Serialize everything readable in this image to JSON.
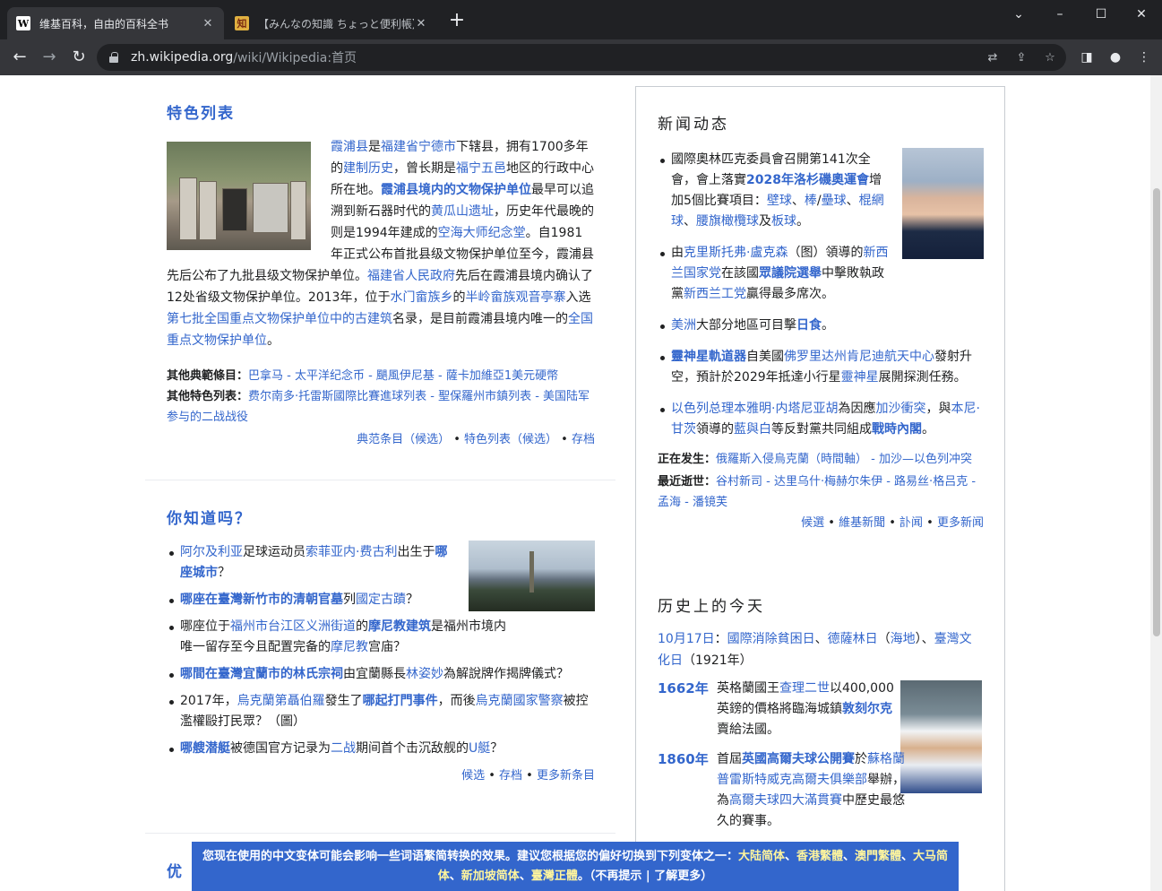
{
  "browser": {
    "tabs": [
      {
        "title": "维基百科，自由的百科全书",
        "favicon": "W",
        "active": true
      },
      {
        "title": "【みんなの知識 ちょっと便利帳】パソコ",
        "favicon": "知",
        "active": false
      }
    ],
    "new_tab": "+",
    "url_host": "zh.wikipedia.org",
    "url_path": "/wiki/Wikipedia:首页",
    "window_controls": {
      "minimize": "–",
      "maximize": "☐",
      "close": "✕",
      "tab_search": "⌄"
    }
  },
  "featured_list": {
    "heading": "特色列表",
    "paragraph": [
      {
        "t": "霞浦县",
        "l": true
      },
      {
        "t": "是",
        "l": false
      },
      {
        "t": "福建省宁德市",
        "l": true
      },
      {
        "t": "下辖县，拥有1700多年的",
        "l": false
      },
      {
        "t": "建制历史",
        "l": true
      },
      {
        "t": "，曾长期是",
        "l": false
      },
      {
        "t": "福宁五邑",
        "l": true
      },
      {
        "t": "地区的行政中心所在地。",
        "l": false
      },
      {
        "t": "霞浦县境内的文物保护单位",
        "l": true,
        "b": true
      },
      {
        "t": "最早可以追溯到新石器时代的",
        "l": false
      },
      {
        "t": "黄瓜山遗址",
        "l": true
      },
      {
        "t": "，历史年代最晚的则是1994年建成的",
        "l": false
      },
      {
        "t": "空海大师纪念堂",
        "l": true
      },
      {
        "t": "。自1981年正式公布首批县级文物保护单位至今，霞浦县先后公布了九批县级文物保护单位。",
        "l": false
      },
      {
        "t": "福建省人民政府",
        "l": true
      },
      {
        "t": "先后在霞浦县境内确认了12处省级文物保护单位。2013年，位于",
        "l": false
      },
      {
        "t": "水门畲族乡",
        "l": true
      },
      {
        "t": "的",
        "l": false
      },
      {
        "t": "半岭畲族观音亭寨",
        "l": true
      },
      {
        "t": "入选",
        "l": false
      },
      {
        "t": "第七批全国重点文物保护单位中的古建筑",
        "l": true
      },
      {
        "t": "名录，是目前霞浦县境内唯一的",
        "l": false
      },
      {
        "t": "全国重点文物保护单位",
        "l": true
      },
      {
        "t": "。",
        "l": false
      }
    ],
    "other_featured_label": "其他典範條目：",
    "other_featured": "巴拿马 - 太平洋纪念币 - 颶風伊尼基 - 薩卡加維亞1美元硬幣",
    "other_lists_label": "其他特色列表：",
    "other_lists": "费尔南多·托雷斯國際比賽進球列表 - 聖保羅州市鎮列表 - 美国陆军参与的二战战役",
    "footer": [
      "典范条目（候选）",
      "特色列表（候选）",
      "存档"
    ]
  },
  "dyk": {
    "heading": "你知道吗？",
    "items": [
      [
        {
          "t": "阿尔及利亚",
          "l": true
        },
        {
          "t": "足球运动员",
          "l": false
        },
        {
          "t": "索菲亚内·费古利",
          "l": true
        },
        {
          "t": "出生于",
          "l": false
        },
        {
          "t": "哪座城市",
          "l": true,
          "b": true
        },
        {
          "t": "？",
          "l": false
        }
      ],
      [
        {
          "t": "哪座在臺灣新竹市的清朝官墓",
          "l": true,
          "b": true
        },
        {
          "t": "列",
          "l": false
        },
        {
          "t": "國定古蹟",
          "l": true
        },
        {
          "t": "？",
          "l": false
        }
      ],
      [
        {
          "t": "哪座位于",
          "l": false
        },
        {
          "t": "福州市台江区义洲街道",
          "l": true
        },
        {
          "t": "的",
          "l": false
        },
        {
          "t": "摩尼教建筑",
          "l": true,
          "b": true
        },
        {
          "t": "是福州市境内唯一留存至今且配置完备的",
          "l": false
        },
        {
          "t": "摩尼教",
          "l": true
        },
        {
          "t": "宫庙？",
          "l": false
        }
      ],
      [
        {
          "t": "哪間在臺灣宜蘭市的林氏宗祠",
          "l": true,
          "b": true
        },
        {
          "t": "由宜蘭縣長",
          "l": false
        },
        {
          "t": "林姿妙",
          "l": true
        },
        {
          "t": "為解說牌作揭牌儀式？",
          "l": false
        }
      ],
      [
        {
          "t": "2017年，",
          "l": false
        },
        {
          "t": "烏克蘭第聶伯羅",
          "l": true
        },
        {
          "t": "發生了",
          "l": false
        },
        {
          "t": "哪起打門事件",
          "l": true,
          "b": true
        },
        {
          "t": "，而後",
          "l": false
        },
        {
          "t": "烏克蘭國家警察",
          "l": true
        },
        {
          "t": "被控濫權毆打民眾？（圖）",
          "l": false
        }
      ],
      [
        {
          "t": "哪艘潜艇",
          "l": true,
          "b": true
        },
        {
          "t": "被德国官方记录为",
          "l": false
        },
        {
          "t": "二战",
          "l": true
        },
        {
          "t": "期间首个击沉敌舰的",
          "l": false
        },
        {
          "t": "U艇",
          "l": true
        },
        {
          "t": "？",
          "l": false
        }
      ]
    ],
    "footer": [
      "候选",
      "存档",
      "更多新条目"
    ]
  },
  "news": {
    "heading": "新闻动态",
    "items": [
      [
        {
          "t": "國際奧林匹克委員會召開第141次全會，會上落實",
          "l": false
        },
        {
          "t": "2028年洛杉磯奧運會",
          "l": true,
          "b": true
        },
        {
          "t": "增加5個比賽項目：",
          "l": false
        },
        {
          "t": "壁球",
          "l": true
        },
        {
          "t": "、",
          "l": false
        },
        {
          "t": "棒",
          "l": true
        },
        {
          "t": "/",
          "l": false
        },
        {
          "t": "壘球",
          "l": true
        },
        {
          "t": "、",
          "l": false
        },
        {
          "t": "棍網球",
          "l": true
        },
        {
          "t": "、",
          "l": false
        },
        {
          "t": "腰旗橄欖球",
          "l": true
        },
        {
          "t": "及",
          "l": false
        },
        {
          "t": "板球",
          "l": true
        },
        {
          "t": "。",
          "l": false
        }
      ],
      [
        {
          "t": "由",
          "l": false
        },
        {
          "t": "克里斯托弗·盧克森",
          "l": true
        },
        {
          "t": "（图）領導的",
          "l": false
        },
        {
          "t": "新西兰国家党",
          "l": true
        },
        {
          "t": "在該國",
          "l": false
        },
        {
          "t": "眾議院選舉",
          "l": true,
          "b": true
        },
        {
          "t": "中擊敗執政黨",
          "l": false
        },
        {
          "t": "新西兰工党",
          "l": true
        },
        {
          "t": "贏得最多席次。",
          "l": false
        }
      ],
      [
        {
          "t": "美洲",
          "l": true
        },
        {
          "t": "大部分地區可目擊",
          "l": false
        },
        {
          "t": "日食",
          "l": true,
          "b": true
        },
        {
          "t": "。",
          "l": false
        }
      ],
      [
        {
          "t": "靈神星軌道器",
          "l": true,
          "b": true
        },
        {
          "t": "自美國",
          "l": false
        },
        {
          "t": "佛罗里达州肯尼迪航天中心",
          "l": true
        },
        {
          "t": "發射升空，預計於2029年抵達小行星",
          "l": false
        },
        {
          "t": "靈神星",
          "l": true
        },
        {
          "t": "展開探測任務。",
          "l": false
        }
      ],
      [
        {
          "t": "以色列总理本雅明·内塔尼亚胡",
          "l": true
        },
        {
          "t": "為因應",
          "l": false
        },
        {
          "t": "加沙衝突",
          "l": true
        },
        {
          "t": "，與",
          "l": false
        },
        {
          "t": "本尼·甘茨",
          "l": true
        },
        {
          "t": "領導的",
          "l": false
        },
        {
          "t": "藍與白",
          "l": true
        },
        {
          "t": "等反對黨共同組成",
          "l": false
        },
        {
          "t": "戰時內閣",
          "l": true,
          "b": true
        },
        {
          "t": "。",
          "l": false
        }
      ]
    ],
    "ongoing_label": "正在发生：",
    "ongoing": "俄羅斯入侵烏克蘭（時間軸） - 加沙—以色列冲突",
    "recent_deaths_label": "最近逝世：",
    "recent_deaths": "谷村新司 - 达里乌什·梅赫尔朱伊 - 路易丝·格吕克 - 孟海 - 潘镜芙",
    "footer": [
      "候選",
      "維基新聞",
      "訃闻",
      "更多新闻"
    ]
  },
  "on_this_day": {
    "heading": "历史上的今天",
    "date_line": [
      {
        "t": "10月17日",
        "l": true
      },
      {
        "t": "：",
        "l": false
      },
      {
        "t": "國際消除貧困日",
        "l": true
      },
      {
        "t": "、",
        "l": false
      },
      {
        "t": "德薩林日",
        "l": true
      },
      {
        "t": "（",
        "l": false
      },
      {
        "t": "海地",
        "l": true
      },
      {
        "t": "）、",
        "l": false
      },
      {
        "t": "臺灣文化日",
        "l": true
      },
      {
        "t": "（1921年）",
        "l": false
      }
    ],
    "events": [
      {
        "year": "1662年",
        "text": [
          {
            "t": "英格蘭國王",
            "l": false
          },
          {
            "t": "查理二世",
            "l": true
          },
          {
            "t": "以400,000英鎊的價格將臨海城鎮",
            "l": false
          },
          {
            "t": "敦刻尔克",
            "l": true,
            "b": true
          },
          {
            "t": "賣給法國。",
            "l": false
          }
        ]
      },
      {
        "year": "1860年",
        "text": [
          {
            "t": "首屆",
            "l": false
          },
          {
            "t": "英國高爾夫球公開賽",
            "l": true,
            "b": true
          },
          {
            "t": "於",
            "l": false
          },
          {
            "t": "蘇格蘭普雷斯特威克高爾夫俱樂部",
            "l": true
          },
          {
            "t": "舉辦，為",
            "l": false
          },
          {
            "t": "高爾夫球四大滿貫賽",
            "l": true
          },
          {
            "t": "中歷史最悠久的賽事。",
            "l": false
          }
        ]
      }
    ]
  },
  "other_title_fragment": "优",
  "notice": {
    "text": "您现在使用的中文变体可能会影响一些词语繁简转换的效果。建议您根据您的偏好切换到下列变体之一：",
    "variants": [
      "大陆简体",
      "香港繁體",
      "澳門繁體",
      "大马简体",
      "新加坡简体",
      "臺灣正體"
    ],
    "dismiss": "不再提示",
    "learn_more": "了解更多"
  },
  "colors": {
    "link": "#3366cc",
    "chrome_dark": "#202124",
    "chrome_tab": "#35363a",
    "notice_bg": "#3366cc",
    "notice_highlight": "#fff59d"
  }
}
